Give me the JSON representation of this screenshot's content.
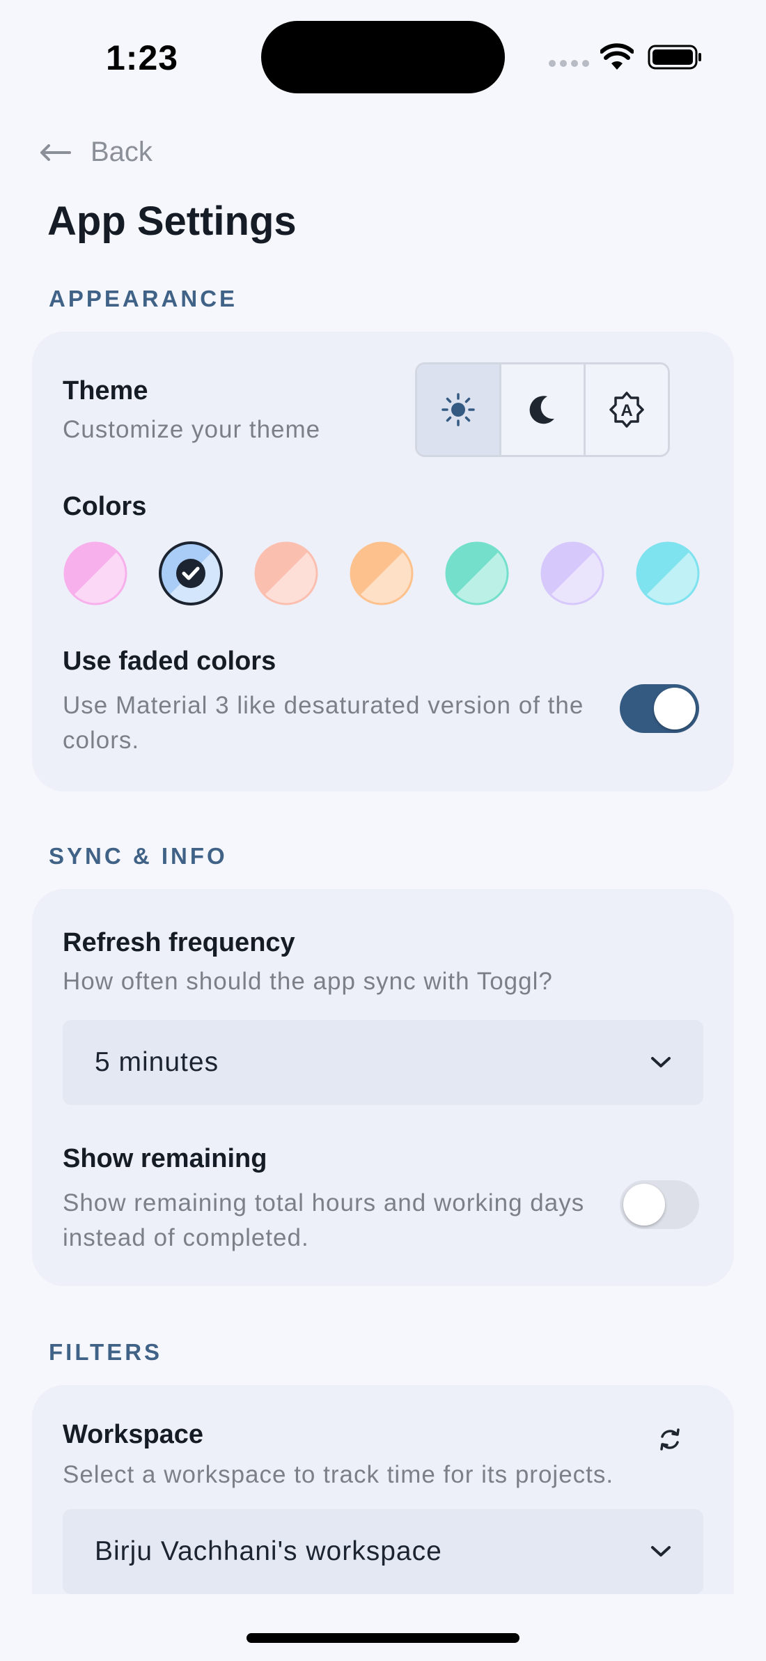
{
  "status_bar": {
    "time": "1:23"
  },
  "nav": {
    "back_label": "Back"
  },
  "page": {
    "title": "App Settings"
  },
  "appearance": {
    "section_label": "APPEARANCE",
    "theme": {
      "title": "Theme",
      "subtitle": "Customize your theme",
      "options": [
        "light-icon",
        "dark-icon",
        "auto-icon"
      ],
      "selected": "light"
    },
    "colors": {
      "title": "Colors",
      "swatches": [
        "#f7b0ec",
        "#a9cdf7",
        "#fbbfb0",
        "#fcc18c",
        "#74e0cb",
        "#d7c8fb",
        "#7ee2ef"
      ],
      "selected_index": 1
    },
    "faded": {
      "title": "Use faded colors",
      "subtitle": "Use Material 3 like desaturated version of the colors.",
      "enabled": true
    }
  },
  "sync": {
    "section_label": "SYNC & INFO",
    "refresh": {
      "title": "Refresh frequency",
      "subtitle": "How often should the app sync with Toggl?",
      "value": "5 minutes"
    },
    "remaining": {
      "title": "Show remaining",
      "subtitle": "Show remaining total hours and working days instead of completed.",
      "enabled": false
    }
  },
  "filters": {
    "section_label": "FILTERS",
    "workspace": {
      "title": "Workspace",
      "subtitle": "Select a workspace to track time for its projects.",
      "value": "Birju Vachhani's workspace"
    }
  },
  "colors": {
    "accent": "#355a82",
    "section": "#3f6286",
    "card": "#eef0f9",
    "background": "#f6f7fc"
  }
}
